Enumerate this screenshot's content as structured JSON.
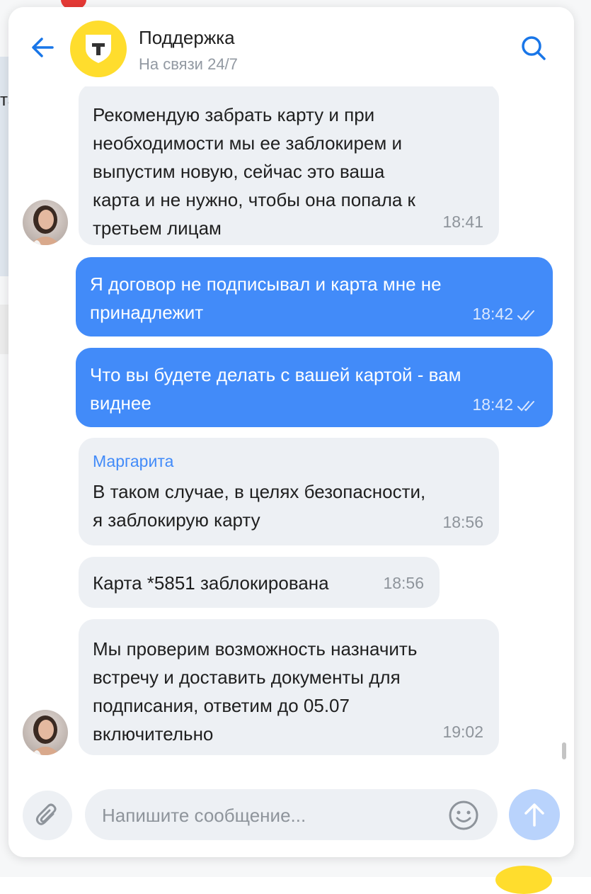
{
  "header": {
    "title": "Поддержка",
    "subtitle": "На связи 24/7",
    "logo_letter": "Т"
  },
  "background": {
    "fragment": "та"
  },
  "messages": [
    {
      "direction": "incoming",
      "text": "Рекомендую забрать карту и при\nнеобходимости мы ее заблокирем и\nвыпустим новую, сейчас это ваша\nкарта и не нужно, чтобы она попала к\nтретьем лицам",
      "time": "18:41",
      "avatar": true
    },
    {
      "direction": "outgoing",
      "text": "Я договор не подписывал и карта мне не\nпринадлежит",
      "time": "18:42",
      "status": "read"
    },
    {
      "direction": "outgoing",
      "text": "Что вы будете делать с вашей картой - вам\nвиднее",
      "time": "18:42",
      "status": "read"
    },
    {
      "direction": "incoming",
      "author": "Маргарита",
      "text": "В таком случае, в целях безопасности,\nя заблокирую карту",
      "time": "18:56"
    },
    {
      "direction": "incoming",
      "text": "Карта *5851 заблокирована",
      "time": "18:56"
    },
    {
      "direction": "incoming",
      "text": "Мы проверим возможность назначить\nвстречу и доставить документы для\nподписания, ответим до 05.07\nвключительно",
      "time": "19:02",
      "avatar": true
    }
  ],
  "composer": {
    "placeholder": "Напишите сообщение..."
  },
  "colors": {
    "accent": "#428bf9",
    "brand_yellow": "#ffdd2d",
    "incoming_bg": "#edf0f4",
    "send_disabled": "#b9d3fc"
  },
  "icons": {
    "back": "arrow-left-icon",
    "search": "search-icon",
    "attach": "paperclip-icon",
    "emoji": "smiley-icon",
    "send": "arrow-up-icon",
    "status": "double-check-icon"
  }
}
